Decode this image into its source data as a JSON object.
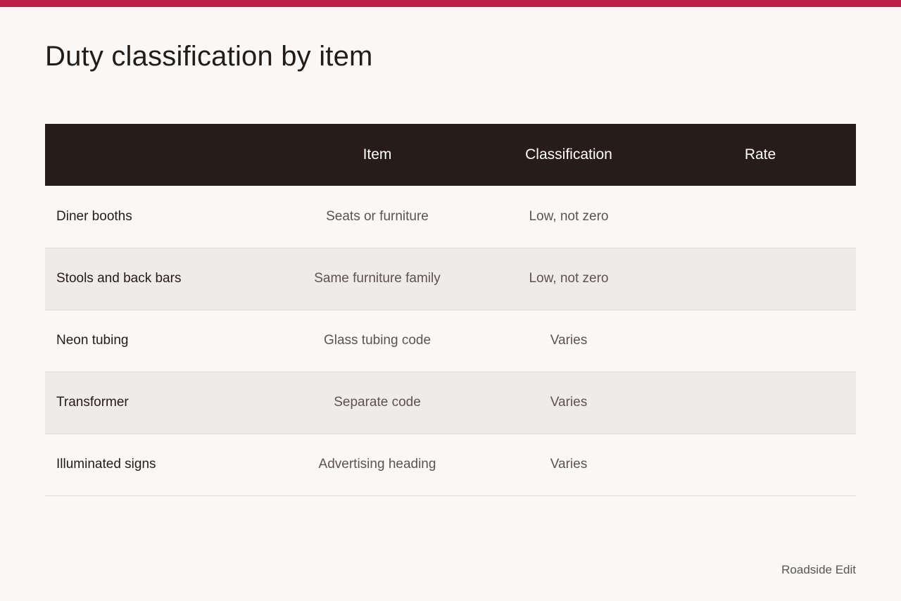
{
  "accent_color": "#bd1e4a",
  "header_bg_color": "#271c17",
  "title": "Duty classification by item",
  "table": {
    "columns": [
      "",
      "Item",
      "Classification",
      "Rate"
    ],
    "rows": [
      [
        "Diner booths",
        "Seats or furniture",
        "Low, not zero",
        ""
      ],
      [
        "Stools and back bars",
        "Same furniture family",
        "Low, not zero",
        ""
      ],
      [
        "Neon tubing",
        "Glass tubing code",
        "Varies",
        ""
      ],
      [
        "Transformer",
        "Separate code",
        "Varies",
        ""
      ],
      [
        "Illuminated signs",
        "Advertising heading",
        "Varies",
        ""
      ]
    ]
  },
  "footer": {
    "brand": "Roadside Edit"
  }
}
